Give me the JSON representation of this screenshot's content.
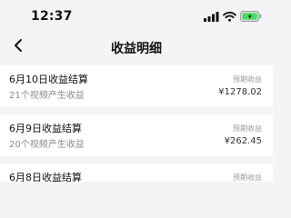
{
  "status_bar": {
    "time": "12:37"
  },
  "nav": {
    "title": "收益明细"
  },
  "items": [
    {
      "title": "6月10日收益结算",
      "subtitle": "21个视频产生收益",
      "label": "预期收益",
      "amount": "¥1278.02"
    },
    {
      "title": "6月9日收益结算",
      "subtitle": "20个视频产生收益",
      "label": "预期收益",
      "amount": "¥262.45"
    },
    {
      "title": "6月8日收益结算",
      "subtitle": "",
      "label": "预期收益",
      "amount": ""
    }
  ],
  "colors": {
    "background": "#f4f4f6",
    "card": "#ffffff",
    "battery_fill": "#4cd964"
  },
  "icons": [
    "cellular-signal-icon",
    "wifi-icon",
    "battery-charging-icon",
    "back-chevron-icon"
  ]
}
